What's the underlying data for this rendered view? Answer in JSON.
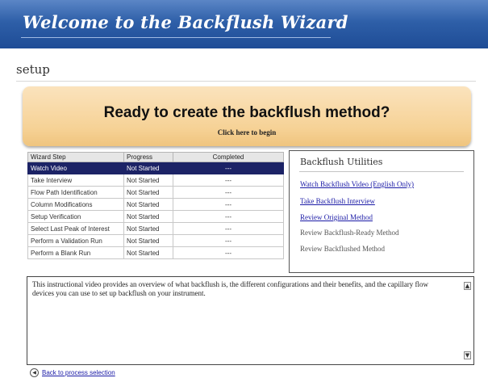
{
  "banner": {
    "title": "Welcome to the Backflush Wizard"
  },
  "section": {
    "title": "setup"
  },
  "ready": {
    "title": "Ready to create the backflush method?",
    "subtitle": "Click here to begin"
  },
  "steps": {
    "headers": [
      "Wizard Step",
      "Progress",
      "Completed"
    ],
    "rows": [
      {
        "step": "Watch Video",
        "progress": "Not Started",
        "completed": "---",
        "selected": true
      },
      {
        "step": "Take Interview",
        "progress": "Not Started",
        "completed": "---"
      },
      {
        "step": "Flow Path Identification",
        "progress": "Not Started",
        "completed": "---"
      },
      {
        "step": "Column Modifications",
        "progress": "Not Started",
        "completed": "---"
      },
      {
        "step": "Setup Verification",
        "progress": "Not Started",
        "completed": "---"
      },
      {
        "step": "Select Last Peak of Interest",
        "progress": "Not Started",
        "completed": "---"
      },
      {
        "step": "Perform a Validation Run",
        "progress": "Not Started",
        "completed": "---"
      },
      {
        "step": "Perform a Blank Run",
        "progress": "Not Started",
        "completed": "---"
      }
    ]
  },
  "utilities": {
    "title": "Backflush Utilities",
    "items": [
      {
        "label": "Watch Backflush Video (English Only)",
        "enabled": true
      },
      {
        "label": "Take Backflush Interview",
        "enabled": true
      },
      {
        "label": "Review Original Method",
        "enabled": true
      },
      {
        "label": "Review Backflush-Ready Method",
        "enabled": false
      },
      {
        "label": "Review Backflushed Method",
        "enabled": false
      }
    ]
  },
  "description": {
    "text": "This instructional video provides an overview of what backflush is, the different configurations and their benefits, and the capillary flow devices you can use to set up backflush on your instrument."
  },
  "footer": {
    "back_label": "Back to process selection"
  },
  "colors": {
    "banner": "#2e5fa8",
    "selected_row": "#1c2366",
    "ready_panel": "#f6d296",
    "link": "#1a1aa6"
  }
}
